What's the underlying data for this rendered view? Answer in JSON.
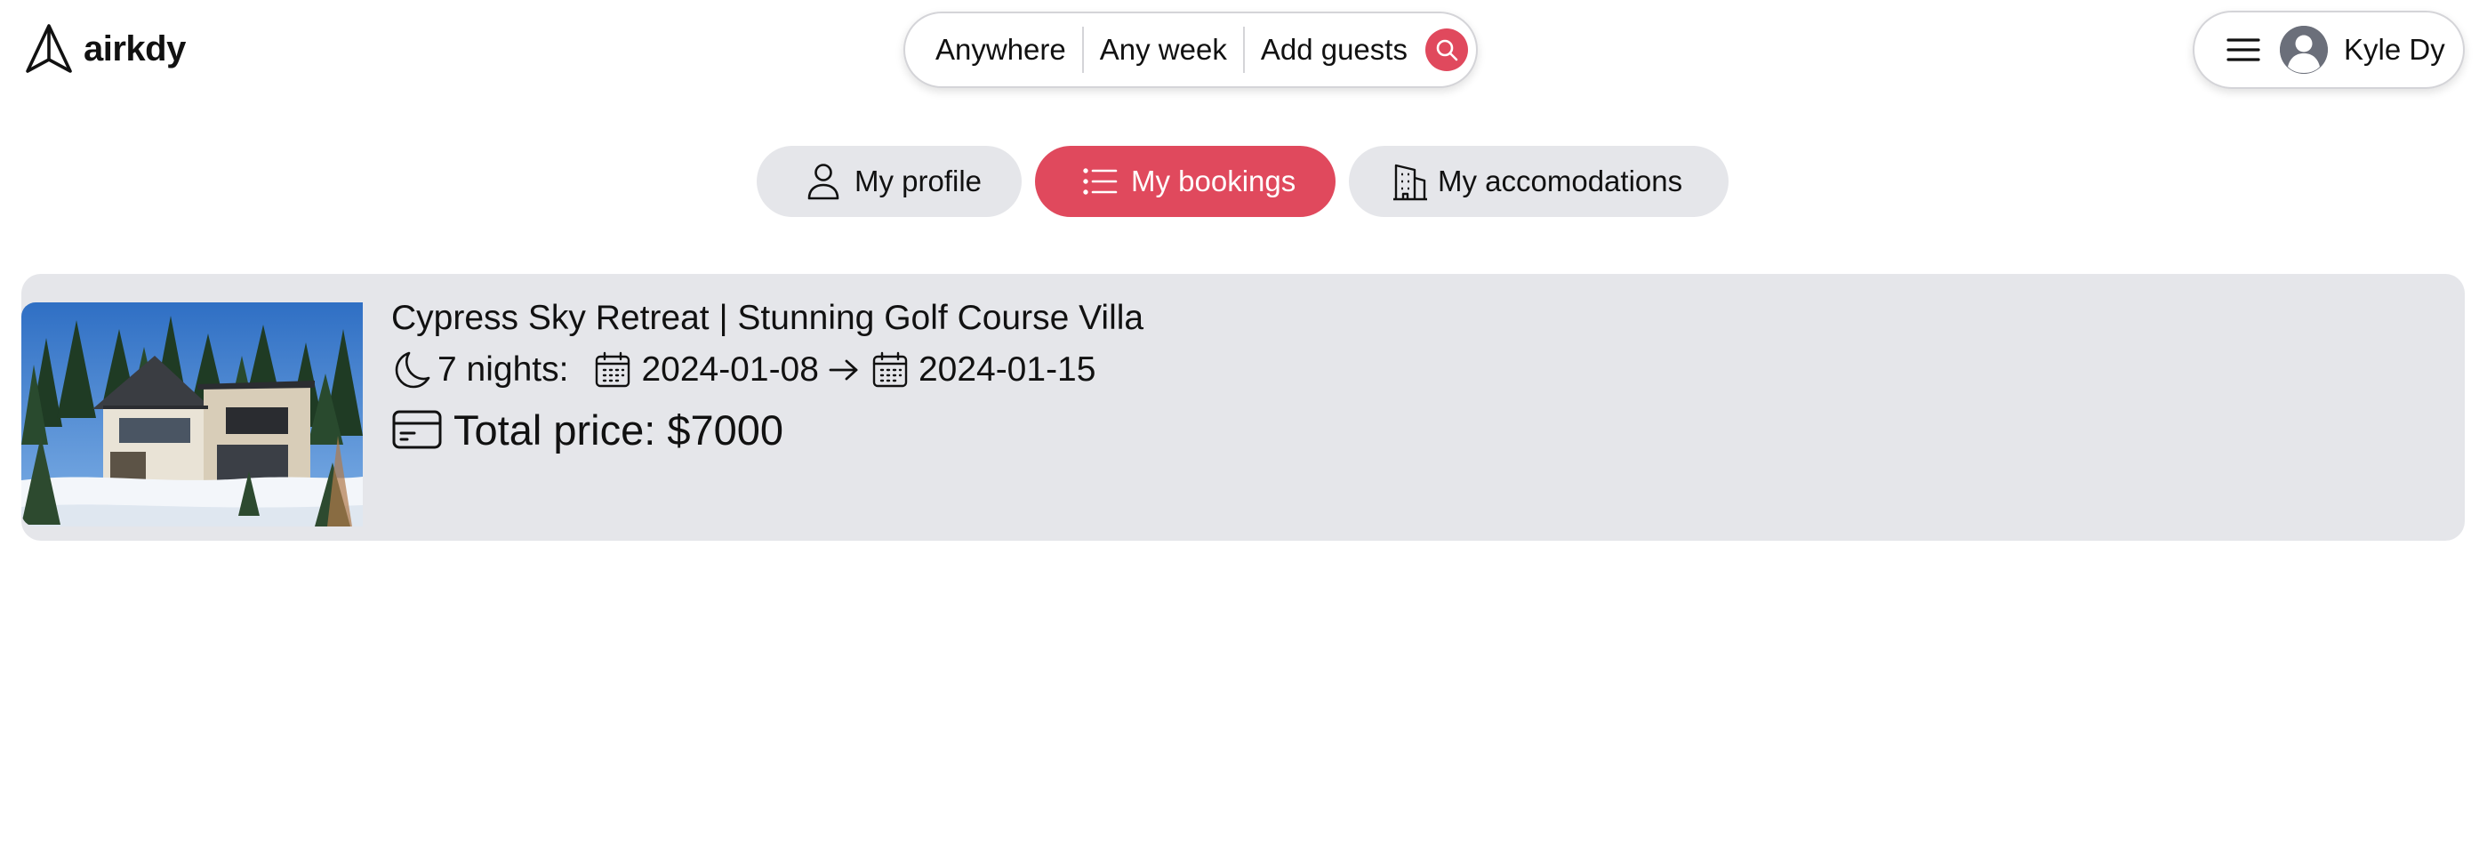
{
  "app": {
    "name": "airkdy"
  },
  "search": {
    "where": "Anywhere",
    "when": "Any week",
    "guests": "Add guests"
  },
  "user": {
    "name": "Kyle Dy"
  },
  "tabs": [
    {
      "label": "My profile",
      "active": false,
      "icon": "person-icon"
    },
    {
      "label": "My bookings",
      "active": true,
      "icon": "list-icon"
    },
    {
      "label": "My accomodations",
      "active": false,
      "icon": "building-icon"
    }
  ],
  "bookings": [
    {
      "title": "Cypress Sky Retreat | Stunning Golf Course Villa",
      "nights_text": "7 nights:",
      "check_in": "2024-01-08",
      "check_out": "2024-01-15",
      "price_text": "Total price: $7000",
      "photo": "modern-chalet-snow-photo"
    }
  ],
  "colors": {
    "accent": "#e0495d",
    "card_bg": "#e5e6ea",
    "text": "#111111"
  }
}
